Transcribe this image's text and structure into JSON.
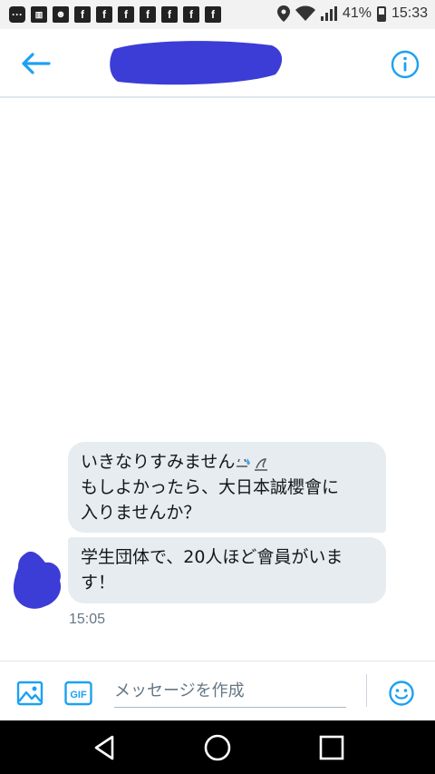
{
  "status_bar": {
    "notification_icons": [
      "messages-icon",
      "sim-icon",
      "contact-icon",
      "facebook-icon",
      "facebook-icon",
      "facebook-icon",
      "facebook-icon",
      "facebook-icon",
      "facebook-icon",
      "facebook-icon"
    ],
    "battery": "41%",
    "time": "15:33"
  },
  "header": {
    "contact_name_redacted": true
  },
  "conversation": {
    "messages": [
      {
        "lines": [
          "いきなりすみません",
          "もしよかったら、大日本誠櫻會に",
          "入りませんか？"
        ]
      },
      {
        "lines": [
          "学生団体で、20人ほど會員がいま",
          "す！"
        ]
      }
    ],
    "timestamp": "15:05"
  },
  "compose": {
    "placeholder": "メッセージを作成",
    "gif_label": "GIF"
  },
  "colors": {
    "accent": "#1da1f2",
    "bubble_bg": "#e6ecf0",
    "redaction": "#3c3cd6"
  }
}
